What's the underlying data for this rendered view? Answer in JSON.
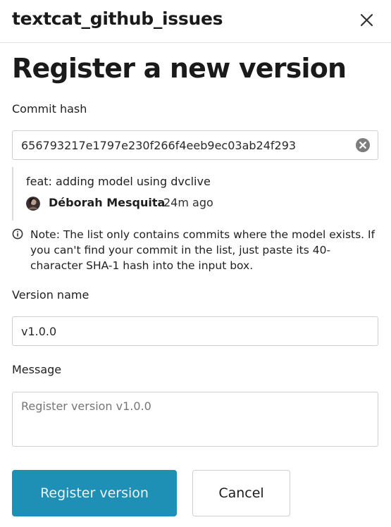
{
  "header": {
    "app_title": "textcat_github_issues"
  },
  "page": {
    "title": "Register a new version"
  },
  "commit": {
    "label": "Commit hash",
    "hash_value": "656793217e1797e230f266f4eeb9ec03ab24f293",
    "message": "feat: adding model using dvclive",
    "author": "Déborah Mesquita",
    "time_ago": "24m ago"
  },
  "note": {
    "text": "Note: The list only contains commits where the model exists. If you can't find your commit in the list, just paste its 40-character SHA-1 hash into the input box."
  },
  "version": {
    "label": "Version name",
    "value": "v1.0.0"
  },
  "message": {
    "label": "Message",
    "placeholder": "Register version v1.0.0"
  },
  "buttons": {
    "register_label": "Register version",
    "cancel_label": "Cancel"
  },
  "colors": {
    "primary": "#1e8fb5",
    "border": "#cfcfcf"
  },
  "icons": {
    "close": "close-icon",
    "clear": "clear-input-icon",
    "info": "info-icon"
  }
}
